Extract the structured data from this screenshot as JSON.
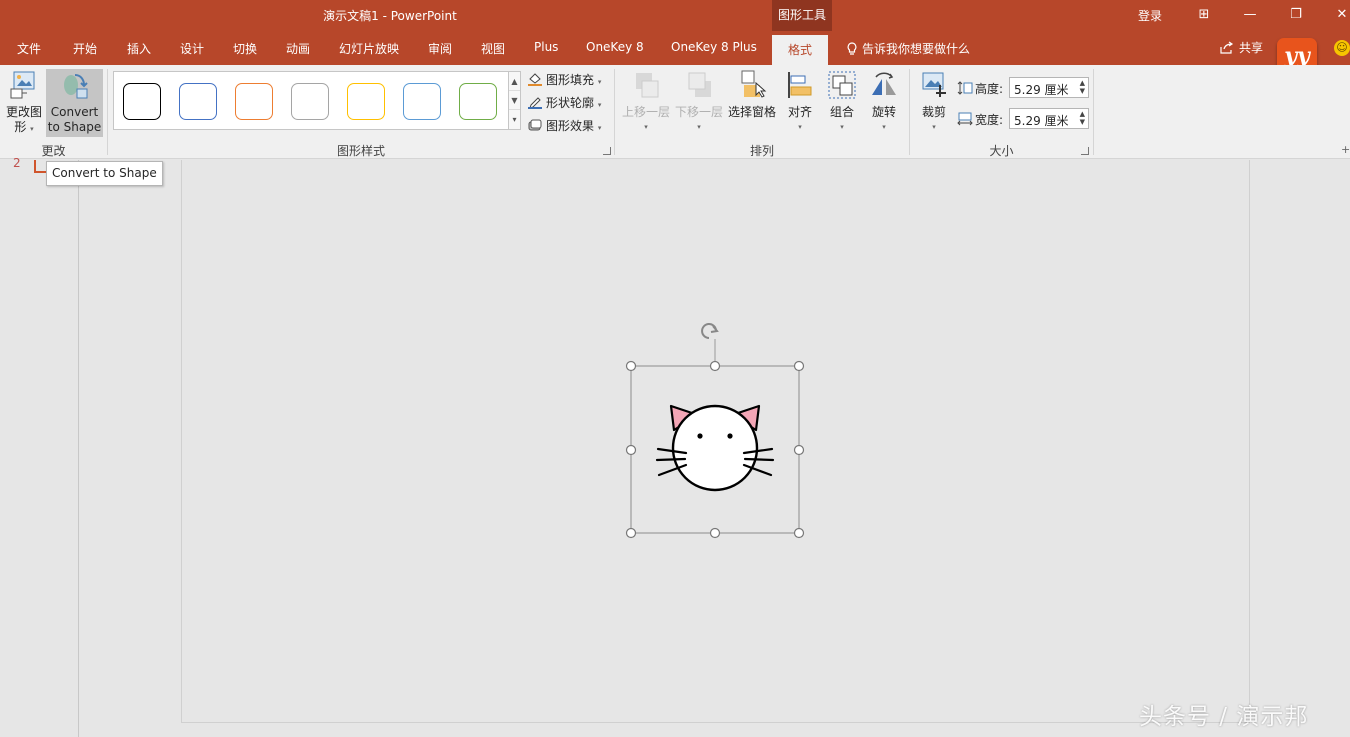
{
  "window": {
    "title": "演示文稿1  -  PowerPoint",
    "context_tab_group": "图形工具",
    "login": "登录",
    "controls": [
      "restore-ribbon",
      "minimize",
      "restore",
      "close"
    ],
    "control_glyphs": [
      "⊞",
      "—",
      "❐",
      "✕"
    ]
  },
  "tabs": [
    "文件",
    "开始",
    "插入",
    "设计",
    "切换",
    "动画",
    "幻灯片放映",
    "审阅",
    "视图",
    "Plus",
    "OneKey 8",
    "OneKey 8 Plus"
  ],
  "active_tab": "格式",
  "tell_me": "告诉我你想要做什么",
  "share": "共享",
  "logo_text": "yy",
  "ribbon": {
    "change_group": {
      "label": "更改",
      "edit_shape_line1": "更改图",
      "edit_shape_line2": "形",
      "convert_line1": "Convert",
      "convert_line2": "to Shape"
    },
    "styles_group": {
      "label": "图形样式",
      "swatch_colors": [
        "#000000",
        "#4472c4",
        "#ed7d31",
        "#a5a5a5",
        "#ffc000",
        "#5b9bd5",
        "#70ad47"
      ],
      "fill": "图形填充",
      "outline": "形状轮廓",
      "effects": "图形效果"
    },
    "arrange_group": {
      "label": "排列",
      "bring_forward": "上移一层",
      "send_backward": "下移一层",
      "selection_pane": "选择窗格",
      "align": "对齐",
      "group": "组合",
      "rotate": "旋转"
    },
    "size_group": {
      "label": "大小",
      "crop": "裁剪",
      "height_label": "高度:",
      "height_value": "5.29 厘米",
      "width_label": "宽度:",
      "width_value": "5.29 厘米"
    }
  },
  "tooltip": "Convert to Shape",
  "slide_number": "2",
  "accent_color": "#b7472a",
  "watermark": "头条号 / 演示邦"
}
